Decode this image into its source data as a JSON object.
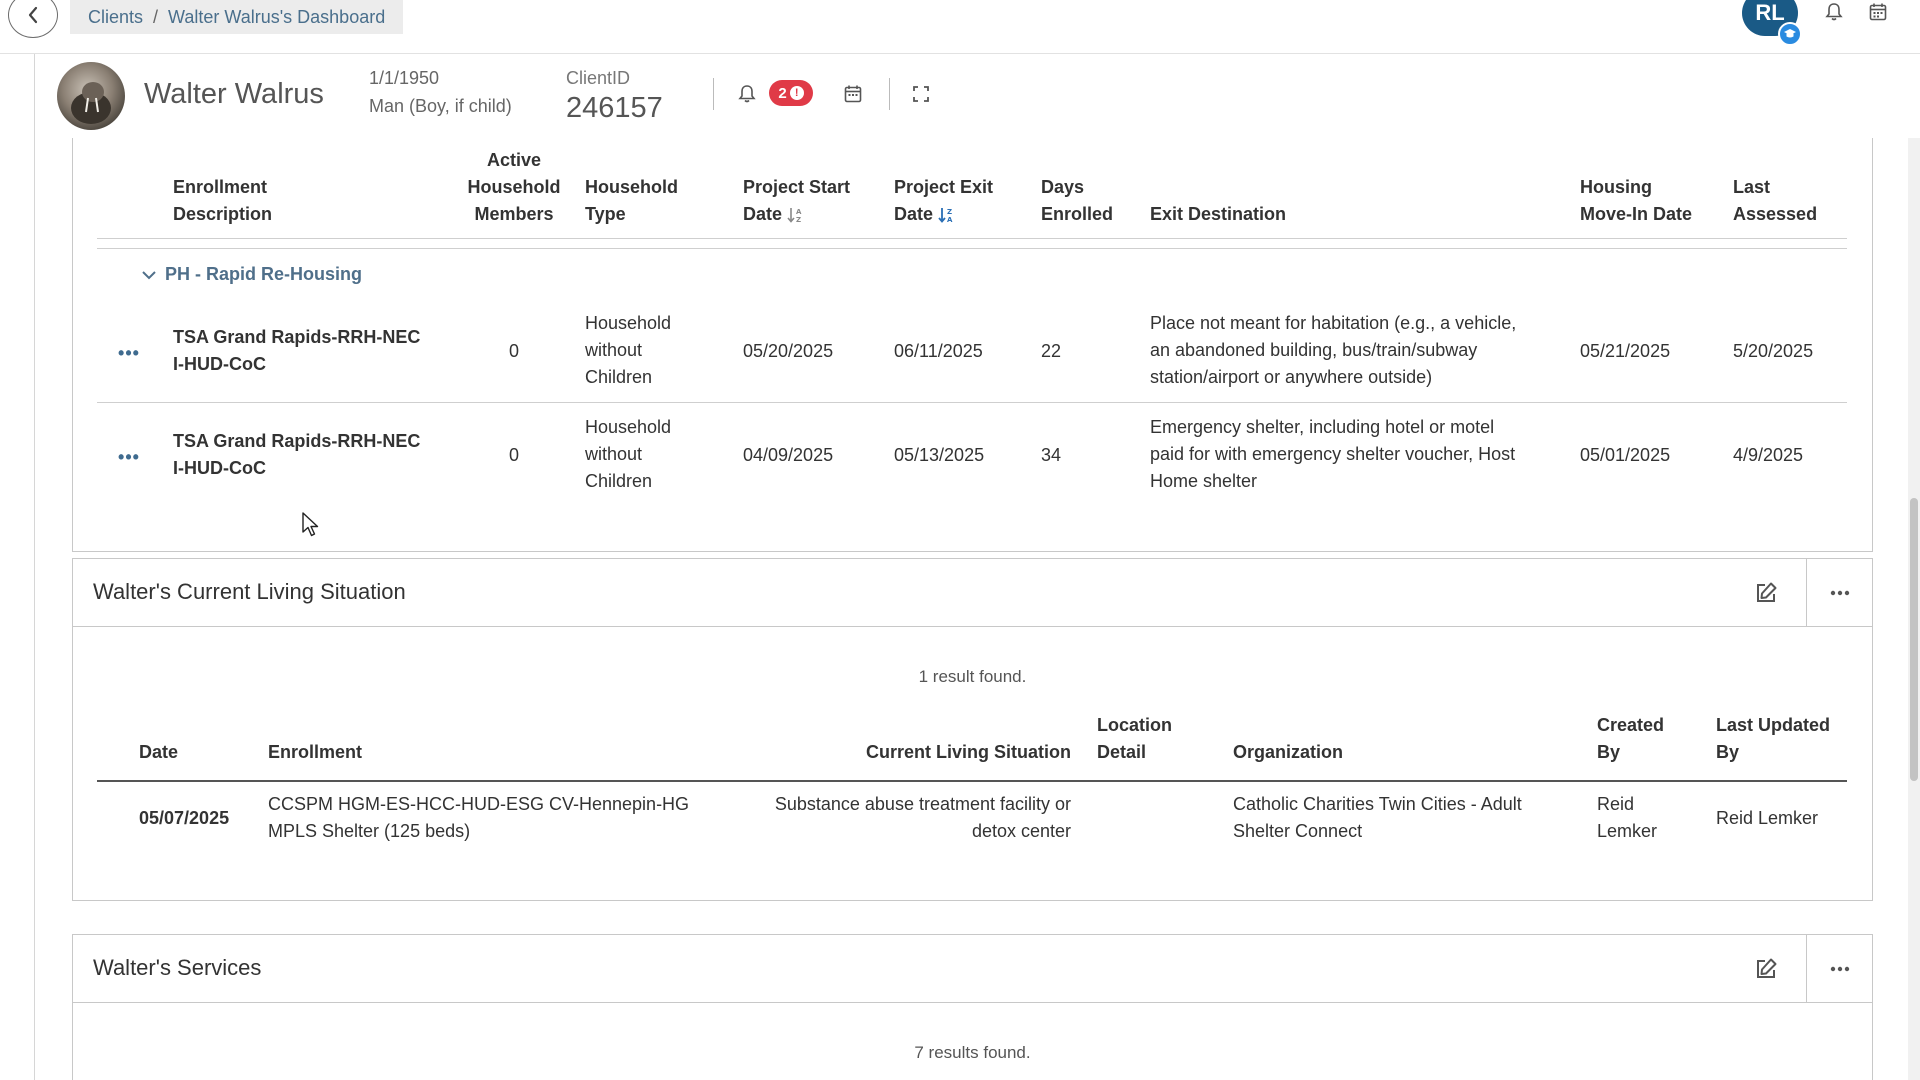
{
  "breadcrumb": {
    "root": "Clients",
    "separator": "/",
    "current": "Walter Walrus's Dashboard"
  },
  "user": {
    "initials": "RL"
  },
  "client": {
    "name": "Walter Walrus",
    "dob": "1/1/1950",
    "gender": "Man (Boy, if child)",
    "id_label": "ClientID",
    "id_value": "246157",
    "alert_count": "2",
    "alert_dot": "!"
  },
  "enrollments": {
    "headers": {
      "description_1": "Enrollment",
      "description_2": "Description",
      "members_1": "Active",
      "members_2": "Household",
      "members_3": "Members",
      "type_1": "Household",
      "type_2": "Type",
      "start_1": "Project Start",
      "start_2": "Date",
      "exit_1": "Project Exit",
      "exit_2": "Date",
      "days_1": "Days",
      "days_2": "Enrolled",
      "destination": "Exit Destination",
      "movein_1": "Housing",
      "movein_2": "Move-In Date",
      "assessed_1": "Last",
      "assessed_2": "Assessed"
    },
    "group_label": "PH - Rapid Re-Housing",
    "rows": [
      {
        "desc_1": "TSA Grand Rapids-RRH-NEC",
        "desc_2": "I-HUD-CoC",
        "members": "0",
        "type_1": "Household",
        "type_2": "without",
        "type_3": "Children",
        "start": "05/20/2025",
        "exit": "06/11/2025",
        "days": "22",
        "dest_1": "Place not meant for habitation (e.g., a vehicle,",
        "dest_2": "an abandoned building, bus/train/subway",
        "dest_3": "station/airport or anywhere outside)",
        "movein": "05/21/2025",
        "assessed": "5/20/2025"
      },
      {
        "desc_1": "TSA Grand Rapids-RRH-NEC",
        "desc_2": "I-HUD-CoC",
        "members": "0",
        "type_1": "Household",
        "type_2": "without",
        "type_3": "Children",
        "start": "04/09/2025",
        "exit": "05/13/2025",
        "days": "34",
        "dest_1": "Emergency shelter, including hotel or motel",
        "dest_2": "paid for with emergency shelter voucher, Host",
        "dest_3": "Home shelter",
        "movein": "05/01/2025",
        "assessed": "4/9/2025"
      }
    ]
  },
  "living_situation": {
    "title": "Walter's Current Living Situation",
    "result_count": "1 result found.",
    "headers": {
      "date": "Date",
      "enrollment": "Enrollment",
      "cls": "Current Living Situation",
      "location_1": "Location",
      "location_2": "Detail",
      "organization": "Organization",
      "created_1": "Created",
      "created_2": "By",
      "updated_1": "Last Updated",
      "updated_2": "By"
    },
    "rows": [
      {
        "date": "05/07/2025",
        "enrollment_1": "CCSPM HGM-ES-HCC-HUD-ESG CV-Hennepin-HG",
        "enrollment_2": "MPLS Shelter (125 beds)",
        "cls_1": "Substance abuse treatment facility or",
        "cls_2": "detox center",
        "location": "",
        "org_1": "Catholic Charities Twin Cities - Adult",
        "org_2": "Shelter Connect",
        "created_1": "Reid",
        "created_2": "Lemker",
        "updated": "Reid Lemker"
      }
    ]
  },
  "services": {
    "title": "Walter's Services",
    "result_count": "7 results found."
  }
}
